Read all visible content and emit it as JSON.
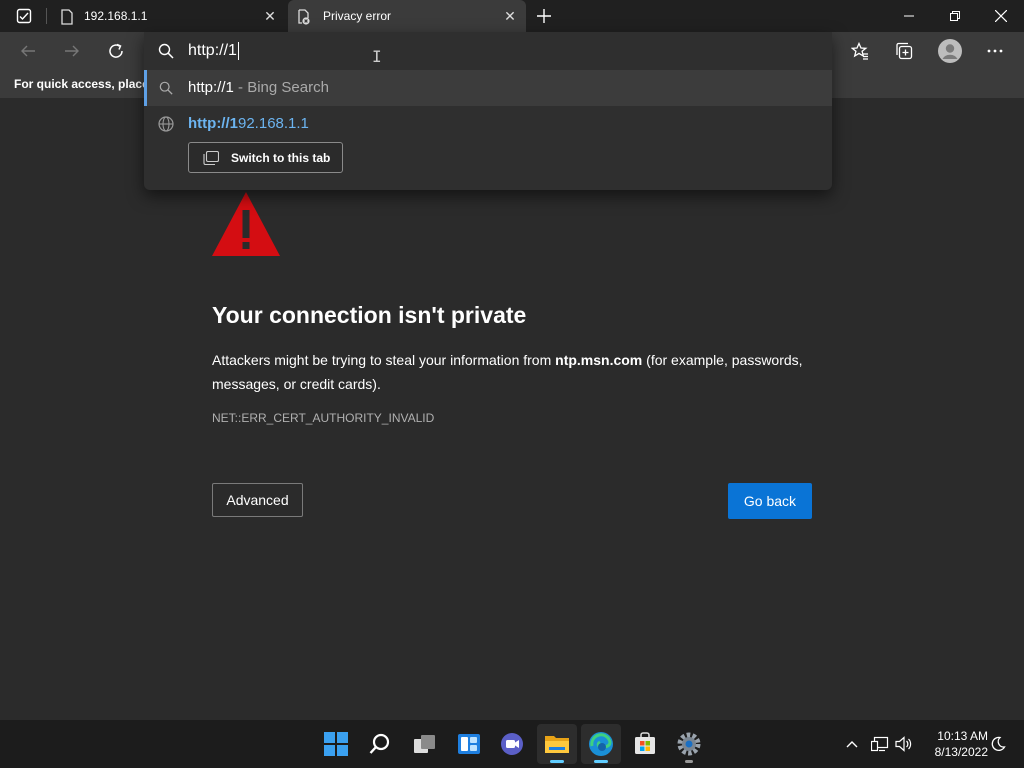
{
  "browser": {
    "tabs": [
      {
        "title": "192.168.1.1"
      },
      {
        "title": "Privacy error"
      }
    ],
    "address_input": {
      "value": "http://1"
    },
    "suggestions": [
      {
        "query": "http://1",
        "source": " - Bing Search"
      },
      {
        "match": "http://1",
        "rest": "92.168.1.1",
        "action_label": "Switch to this tab"
      }
    ],
    "favorites_bar_hint": "For quick access, place y"
  },
  "error_page": {
    "title": "Your connection isn't private",
    "description_before": "Attackers might be trying to steal your information from ",
    "domain": "ntp.msn.com",
    "description_after": " (for example, passwords, messages, or credit cards).",
    "error_code": "NET::ERR_CERT_AUTHORITY_INVALID",
    "advanced_label": "Advanced",
    "go_back_label": "Go back"
  },
  "taskbar": {
    "apps": [
      "start-icon",
      "search-icon",
      "task-view-icon",
      "widgets-icon",
      "chat-icon",
      "file-explorer-icon",
      "edge-icon",
      "store-icon",
      "settings-icon"
    ],
    "time": "10:13 AM",
    "date": "8/13/2022"
  },
  "colors": {
    "accent": "#0a74d6",
    "warning_red": "#d40d12",
    "link_blue": "#6cb4f0"
  }
}
